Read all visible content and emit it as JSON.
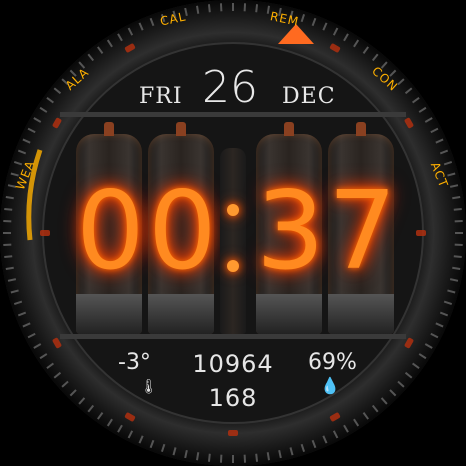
{
  "complications": {
    "cal": "CAL",
    "rem": "REM",
    "ala": "ALA",
    "con": "CON",
    "wea": "WEA",
    "act": "ACT"
  },
  "date": {
    "day_of_week": "FRI",
    "day": "26",
    "month": "DEC"
  },
  "time": {
    "h1": "0",
    "h2": "0",
    "m1": "3",
    "m2": "7"
  },
  "stats": {
    "temperature": "-3°",
    "steps": "10964",
    "calories": "168",
    "humidity": "69%"
  },
  "icons": {
    "temperature": "thermometer-icon",
    "humidity": "water-drop-icon"
  },
  "colors": {
    "accent": "#ffb000",
    "nixie_glow": "#ff8a20",
    "indicator": "#ff6a20"
  }
}
